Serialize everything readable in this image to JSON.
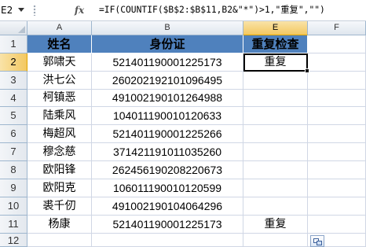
{
  "formula_bar": {
    "name_box": "E2",
    "fx_label": "fx",
    "formula": "=IF(COUNTIF($B$2:$B$11,B2&\"*\")>1,\"重复\",\"\")"
  },
  "columns": [
    "A",
    "B",
    "E",
    "F"
  ],
  "rows": [
    "1",
    "2",
    "3",
    "4",
    "5",
    "6",
    "7",
    "8",
    "9",
    "10",
    "11",
    "12"
  ],
  "header_row": {
    "name": "姓名",
    "id": "身份证",
    "check": "重复检查"
  },
  "data_rows": [
    {
      "name": "郭啸天",
      "id": "521401190001225173",
      "check": "重复"
    },
    {
      "name": "洪七公",
      "id": "260202192101096495",
      "check": ""
    },
    {
      "name": "柯镇恶",
      "id": "491002190101264988",
      "check": ""
    },
    {
      "name": "陆乘风",
      "id": "104011190010120633",
      "check": ""
    },
    {
      "name": "梅超风",
      "id": "521401190001225266",
      "check": ""
    },
    {
      "name": "穆念慈",
      "id": "371421191011035260",
      "check": ""
    },
    {
      "name": "欧阳锋",
      "id": "262456190208220673",
      "check": ""
    },
    {
      "name": "欧阳克",
      "id": "106011190010120599",
      "check": ""
    },
    {
      "name": "裘千仞",
      "id": "491002190104064296",
      "check": ""
    },
    {
      "name": "杨康",
      "id": "521401190001225173",
      "check": "重复"
    }
  ],
  "colors": {
    "header_fill": "#4f81bd",
    "selection": "#f3c861",
    "gridline": "#d0d7e5"
  }
}
